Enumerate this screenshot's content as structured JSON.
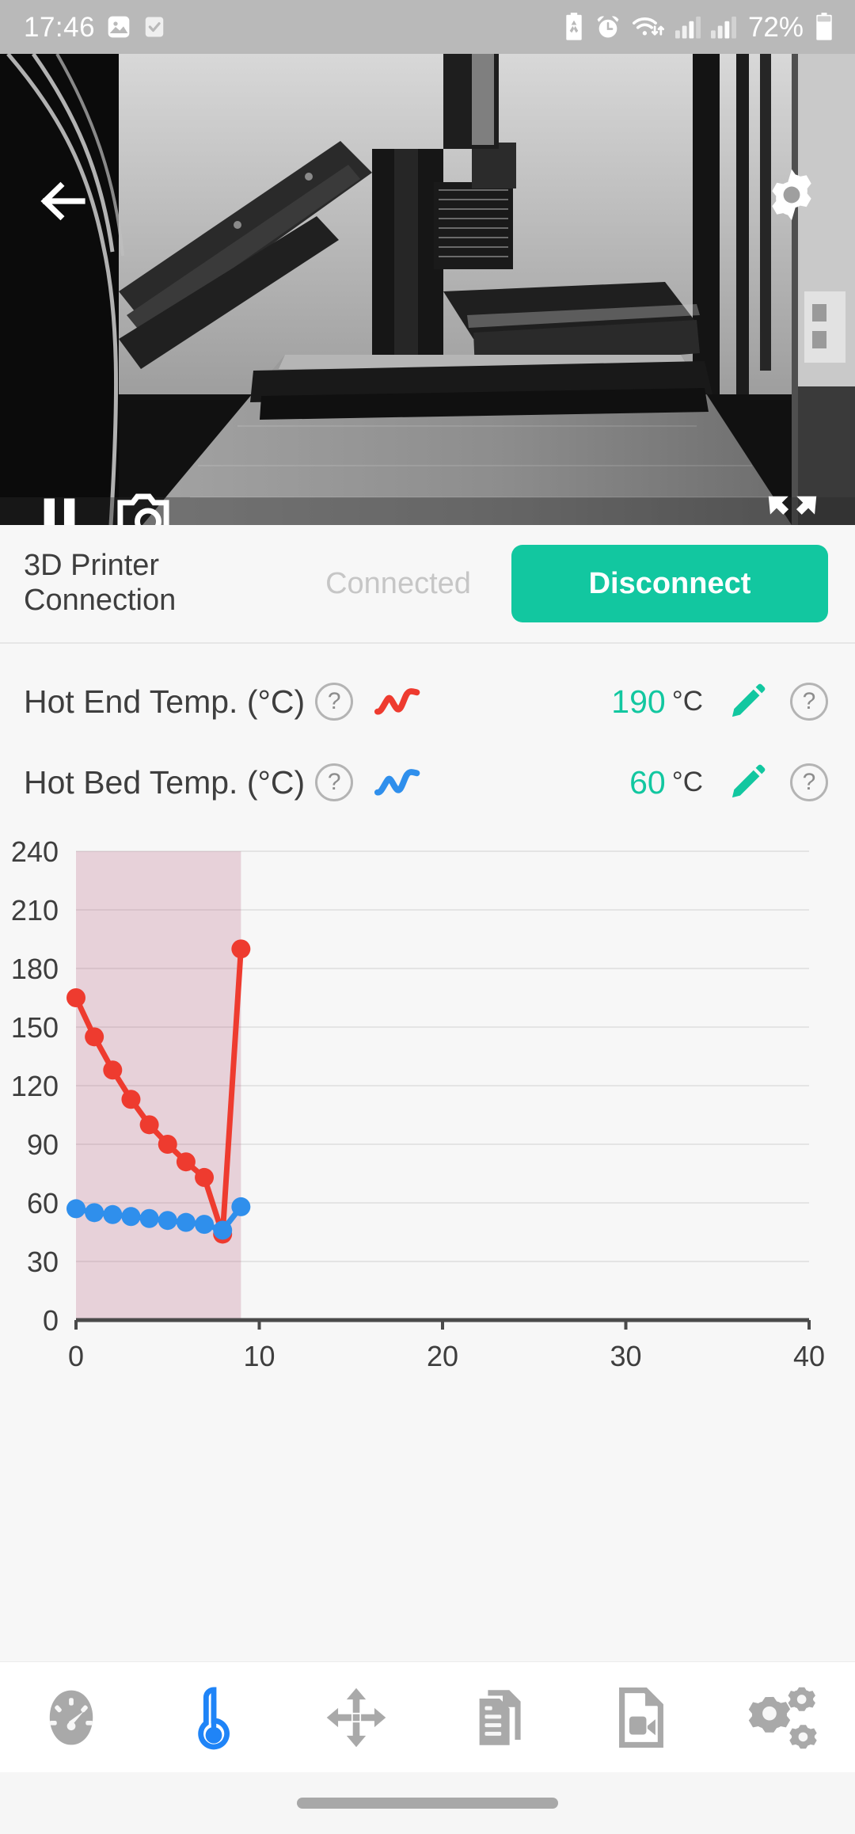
{
  "status_bar": {
    "time": "17:46",
    "battery_percent": "72%",
    "left_icons": [
      "photo-icon",
      "task-check-icon"
    ],
    "right_icons": [
      "battery-saver-icon",
      "alarm-clock-icon",
      "wifi-icon",
      "signal-bars-1-icon",
      "signal-bars-2-icon",
      "battery-icon"
    ]
  },
  "webcam": {
    "back_icon": "arrow-left-icon",
    "settings_icon": "gear-icon",
    "pause_icon": "pause-icon",
    "snapshot_icon": "camera-icon",
    "fullscreen_icon": "fullscreen-expand-icon"
  },
  "connection": {
    "title": "3D Printer\nConnection",
    "title_line1": "3D Printer",
    "title_line2": "Connection",
    "status": "Connected",
    "button_label": "Disconnect",
    "accent_color": "#12c7a0"
  },
  "temperatures": {
    "rows": [
      {
        "label": "Hot End Temp. (°C)",
        "help_glyph": "?",
        "series_icon": "red-sparkline-icon",
        "series_color": "#ee3b2f",
        "value": "190",
        "unit": "°C",
        "edit_icon": "pencil-icon",
        "value_help_glyph": "?"
      },
      {
        "label": "Hot Bed Temp. (°C)",
        "help_glyph": "?",
        "series_icon": "blue-sparkline-icon",
        "series_color": "#2f8fec",
        "value": "60",
        "unit": "°C",
        "edit_icon": "pencil-icon",
        "value_help_glyph": "?"
      }
    ]
  },
  "chart_data": {
    "type": "line",
    "title": "",
    "xlabel": "",
    "ylabel": "",
    "xlim": [
      0,
      40
    ],
    "ylim": [
      0,
      240
    ],
    "x_ticks": [
      0,
      10,
      20,
      30,
      40
    ],
    "y_ticks": [
      0,
      30,
      60,
      90,
      120,
      150,
      180,
      210,
      240
    ],
    "x_tick_labels": [
      "0",
      "10",
      "20",
      "30",
      "40"
    ],
    "y_tick_labels": [
      "0",
      "30",
      "60",
      "90",
      "120",
      "150",
      "180",
      "210",
      "240"
    ],
    "grid": true,
    "legend": "none",
    "x": [
      0,
      1,
      2,
      3,
      4,
      5,
      6,
      7,
      8,
      9
    ],
    "series": [
      {
        "name": "Hot End Temp. (°C)",
        "color": "#ee3b2f",
        "fill": "rgba(238,59,47,0.10)",
        "values": [
          165,
          145,
          128,
          113,
          100,
          90,
          81,
          73,
          44,
          190
        ]
      },
      {
        "name": "Hot Bed Temp. (°C)",
        "color": "#2f8fec",
        "fill": "rgba(120,90,170,0.13)",
        "values": [
          57,
          55,
          54,
          53,
          52,
          51,
          50,
          49,
          46,
          58
        ]
      }
    ]
  },
  "bottom_nav": {
    "active_index": 1,
    "active_color": "#1f84f7",
    "inactive_color": "#a9a9a9",
    "items": [
      {
        "name": "dashboard",
        "icon": "gauge-icon"
      },
      {
        "name": "temperature",
        "icon": "thermometer-icon"
      },
      {
        "name": "move",
        "icon": "move-arrows-icon"
      },
      {
        "name": "files",
        "icon": "gcode-files-icon"
      },
      {
        "name": "video",
        "icon": "video-file-icon"
      },
      {
        "name": "settings",
        "icon": "gears-icon"
      }
    ]
  }
}
